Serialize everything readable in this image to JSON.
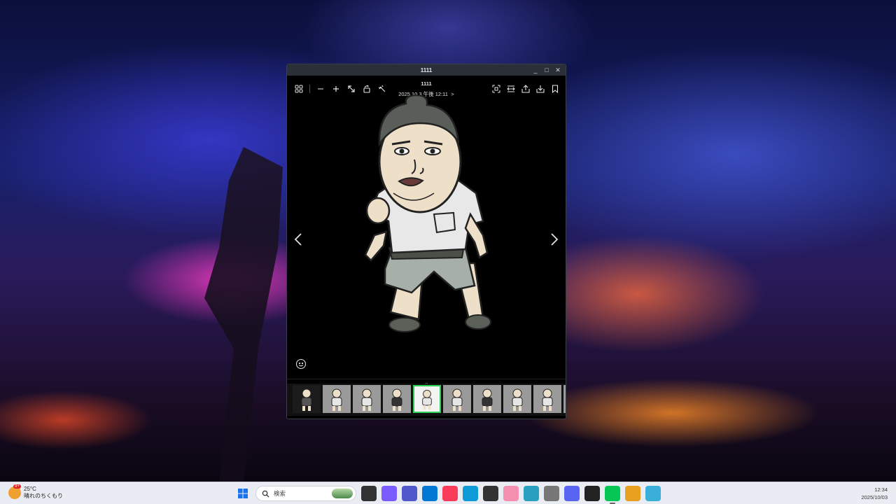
{
  "window": {
    "title": "1111",
    "minimize_glyph": "_",
    "maximize_glyph": "□",
    "close_glyph": "✕"
  },
  "viewer": {
    "photo_name": "1111",
    "photo_date": "2025.10.3 午後 12:11",
    "date_chevron": ">",
    "left_tools": [
      "grid-icon",
      "zoom-out-icon",
      "zoom-in-icon",
      "expand-icon",
      "rotate-icon",
      "edit-icon"
    ],
    "right_tools": [
      "fit-icon",
      "fullscreen-icon",
      "share-icon",
      "download-icon",
      "bookmark-icon"
    ],
    "collapse_glyph": "⌄"
  },
  "filmstrip": {
    "count": 10,
    "selected_index": 4
  },
  "taskbar": {
    "weather_badge": "9+",
    "temperature": "25°C",
    "condition": "晴れのちくもり",
    "search_placeholder": "検索",
    "time": "12:34",
    "date": "2025/10/03",
    "apps": [
      {
        "name": "task-view",
        "color": "#333333"
      },
      {
        "name": "copilot",
        "color": "#7b5cff"
      },
      {
        "name": "teams",
        "color": "#5059c9"
      },
      {
        "name": "store",
        "color": "#0078d4"
      },
      {
        "name": "music",
        "color": "#fa3b5a"
      },
      {
        "name": "edge",
        "color": "#0f9bd7"
      },
      {
        "name": "camera",
        "color": "#333333"
      },
      {
        "name": "kirby",
        "color": "#f58fb0"
      },
      {
        "name": "apps-game",
        "color": "#2aa0c0"
      },
      {
        "name": "speaker",
        "color": "#777777"
      },
      {
        "name": "discord",
        "color": "#5865f2"
      },
      {
        "name": "netkeiba",
        "color": "#222222"
      },
      {
        "name": "line",
        "color": "#06c755"
      },
      {
        "name": "coin",
        "color": "#e8a020"
      },
      {
        "name": "notepad",
        "color": "#3ab0d8"
      }
    ]
  }
}
